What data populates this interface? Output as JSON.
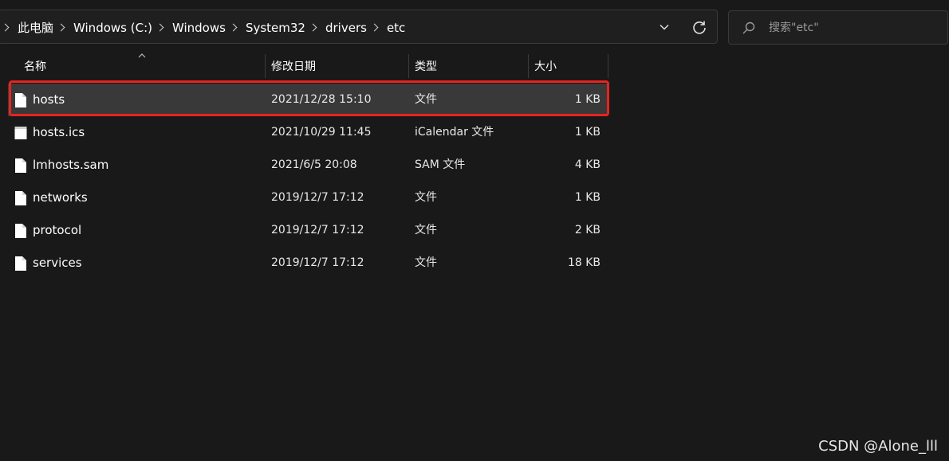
{
  "address_bar": {
    "crumbs": [
      "此电脑",
      "Windows (C:)",
      "Windows",
      "System32",
      "drivers",
      "etc"
    ]
  },
  "search": {
    "placeholder": "搜索\"etc\""
  },
  "columns": {
    "name": "名称",
    "date": "修改日期",
    "type": "类型",
    "size": "大小"
  },
  "files": [
    {
      "name": "hosts",
      "date": "2021/12/28 15:10",
      "type": "文件",
      "size": "1 KB",
      "icon": "blank-file-icon"
    },
    {
      "name": "hosts.ics",
      "date": "2021/10/29 11:45",
      "type": "iCalendar 文件",
      "size": "1 KB",
      "icon": "calendar-file-icon"
    },
    {
      "name": "lmhosts.sam",
      "date": "2021/6/5 20:08",
      "type": "SAM 文件",
      "size": "4 KB",
      "icon": "blank-file-icon"
    },
    {
      "name": "networks",
      "date": "2019/12/7 17:12",
      "type": "文件",
      "size": "1 KB",
      "icon": "blank-file-icon"
    },
    {
      "name": "protocol",
      "date": "2019/12/7 17:12",
      "type": "文件",
      "size": "2 KB",
      "icon": "blank-file-icon"
    },
    {
      "name": "services",
      "date": "2019/12/7 17:12",
      "type": "文件",
      "size": "18 KB",
      "icon": "blank-file-icon"
    }
  ],
  "watermark": "CSDN @Alone_lll",
  "colors": {
    "background": "#191919",
    "selected_row": "#393939",
    "highlight": "#e8231f"
  }
}
